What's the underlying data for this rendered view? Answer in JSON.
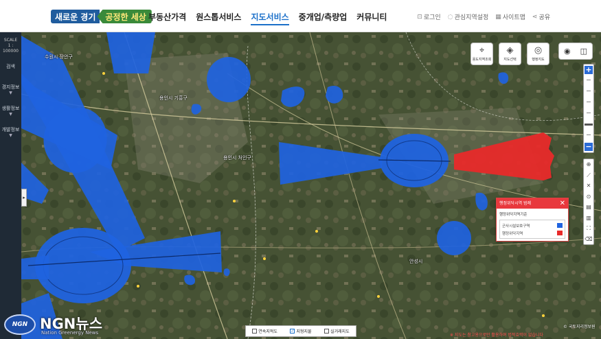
{
  "header": {
    "logo_part1": "새로운 경기",
    "logo_part2": "공정한 세상",
    "nav": [
      "부동산가격",
      "원스톱서비스",
      "지도서비스",
      "중개업/측량업",
      "커뮤니티"
    ],
    "active_nav": "지도서비스",
    "util": [
      {
        "icon": "user-icon",
        "glyph": "⊡",
        "label": "로그인"
      },
      {
        "icon": "pin-icon",
        "glyph": "◌",
        "label": "관심지역설정"
      },
      {
        "icon": "sitemap-icon",
        "glyph": "▦",
        "label": "사이트맵"
      },
      {
        "icon": "share-icon",
        "glyph": "⋖",
        "label": "공유"
      }
    ]
  },
  "sidebar": {
    "scale_label": "SCALE",
    "scale_value": "1 : 100000",
    "items": [
      "검색",
      "경지정보",
      "생활정보",
      "개발정보"
    ]
  },
  "tools": [
    {
      "icon": "distance-icon",
      "glyph": "⌖",
      "label": "용도지역조회"
    },
    {
      "icon": "layers-icon",
      "glyph": "◈",
      "label": "지도선택"
    },
    {
      "icon": "target-icon",
      "glyph": "◎",
      "label": "행정지도"
    }
  ],
  "map_labels": {
    "suwon": "수원시 장안구",
    "yongin_giheung": "용인시 기흥구",
    "yongin_cheoin": "용인시 처인구",
    "anseong": "안성시"
  },
  "legend": {
    "title": "행정위닥시역 범례",
    "subtitle": "행정위닥지역기준",
    "rows": [
      {
        "label": "군사시설보호구역",
        "color": "#1f63e0"
      },
      {
        "label": "행정위닥지역",
        "color": "#e82a2a"
      }
    ]
  },
  "bottom": {
    "items": [
      {
        "label": "연속지적도",
        "checked": false
      },
      {
        "label": "지형지물",
        "checked": true
      },
      {
        "label": "실거래지도",
        "checked": false
      }
    ]
  },
  "notice": "※ 지도는 참고용으로만 활용하며 법적효력이 없습니다",
  "copyright": "© 국토지리정보원",
  "watermark": {
    "logo": "NGN",
    "name": "NGN뉴스",
    "sub": "Nation Greenergy News"
  },
  "colors": {
    "zone_blue": "#1f63e0",
    "zone_red": "#e82a2a",
    "sidebar": "#1f2a36",
    "active_nav": "#1a6fc9"
  }
}
